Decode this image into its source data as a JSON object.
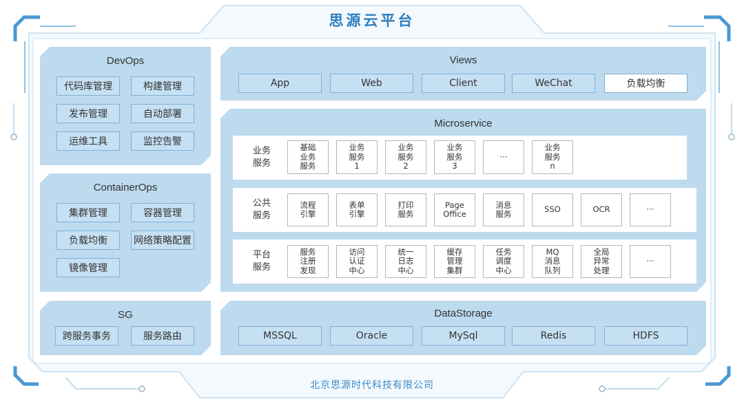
{
  "title": "思源云平台",
  "footer": "北京思源时代科技有限公司",
  "colors": {
    "title": "#2b7fc0",
    "panel": "#bddaef",
    "box_border": "#7fb0d6",
    "frame_accent": "#4a9ad4"
  },
  "devops": {
    "title": "DevOps",
    "items": [
      "代码库管理",
      "构建管理",
      "发布管理",
      "自动部署",
      "运维工具",
      "监控告警"
    ]
  },
  "containerops": {
    "title": "ContainerOps",
    "items": [
      "集群管理",
      "容器管理",
      "负载均衡",
      "网络策略配置",
      "镜像管理"
    ]
  },
  "sg": {
    "title": "SG",
    "items": [
      "跨服务事务",
      "服务路由"
    ]
  },
  "views": {
    "title": "Views",
    "items": [
      "App",
      "Web",
      "Client",
      "WeChat",
      "负载均衡"
    ]
  },
  "microservice": {
    "title": "Microservice",
    "rows": [
      {
        "label": "业务\n服务",
        "items": [
          "基础\n业务\n服务",
          "业务\n服务\n1",
          "业务\n服务\n2",
          "业务\n服务\n3",
          "···",
          "业务\n服务\nn"
        ]
      },
      {
        "label": "公共\n服务",
        "items": [
          "流程\n引擎",
          "表单\n引擎",
          "打印\n服务",
          "Page\nOffice",
          "消息\n服务",
          "SSO",
          "OCR",
          "···"
        ]
      },
      {
        "label": "平台\n服务",
        "items": [
          "服务\n注册\n发现",
          "访问\n认证\n中心",
          "统一\n日志\n中心",
          "缓存\n管理\n集群",
          "任务\n调度\n中心",
          "MQ\n消息\n队列",
          "全局\n异常\n处理",
          "···"
        ]
      }
    ]
  },
  "datastorage": {
    "title": "DataStorage",
    "items": [
      "MSSQL",
      "Oracle",
      "MySql",
      "Redis",
      "HDFS"
    ]
  }
}
